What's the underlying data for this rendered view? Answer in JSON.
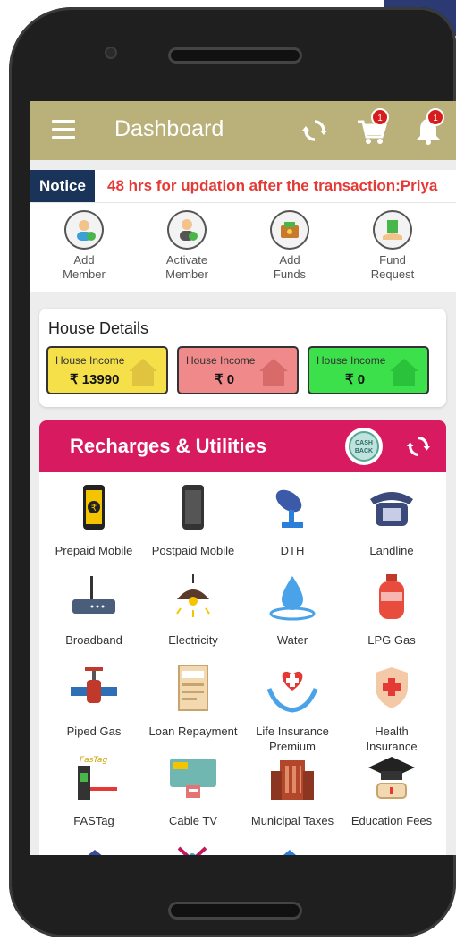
{
  "app": {
    "title": "Dashboard",
    "cart_count": "1",
    "notification_count": "1"
  },
  "notice": {
    "label": "Notice",
    "text": "48 hrs for updation after the transaction:Priya"
  },
  "quick_actions": [
    {
      "label": "Add\nMember",
      "icon": "add-member-icon"
    },
    {
      "label": "Activate\nMember",
      "icon": "activate-member-icon"
    },
    {
      "label": "Add\nFunds",
      "icon": "add-funds-icon"
    },
    {
      "label": "Fund\nRequest",
      "icon": "fund-request-icon"
    }
  ],
  "house": {
    "title": "House Details",
    "boxes": [
      {
        "label": "House Income",
        "value": "₹ 13990",
        "color": "#f5e04a"
      },
      {
        "label": "House Income",
        "value": "₹ 0",
        "color": "#f08a8a"
      },
      {
        "label": "House Income",
        "value": "₹ 0",
        "color": "#3be04a"
      }
    ]
  },
  "recharges": {
    "title": "Recharges & Utilities",
    "cashback_text": "CASH BACK",
    "items": [
      {
        "label": "Prepaid Mobile",
        "icon": "prepaid-mobile-icon"
      },
      {
        "label": "Postpaid Mobile",
        "icon": "postpaid-mobile-icon"
      },
      {
        "label": "DTH",
        "icon": "dth-dish-icon"
      },
      {
        "label": "Landline",
        "icon": "landline-phone-icon"
      },
      {
        "label": "Broadband",
        "icon": "router-icon"
      },
      {
        "label": "Electricity",
        "icon": "lamp-icon"
      },
      {
        "label": "Water",
        "icon": "water-drop-icon"
      },
      {
        "label": "LPG Gas",
        "icon": "gas-cylinder-icon"
      },
      {
        "label": "Piped Gas",
        "icon": "gas-pipe-icon"
      },
      {
        "label": "Loan Repayment",
        "icon": "loan-document-icon"
      },
      {
        "label": "Life Insurance\nPremium",
        "icon": "heart-hands-icon"
      },
      {
        "label": "Health\nInsurance",
        "icon": "health-shield-icon"
      },
      {
        "label": "FASTag",
        "icon": "fastag-toll-icon"
      },
      {
        "label": "Cable TV",
        "icon": "cable-tv-icon"
      },
      {
        "label": "Municipal Taxes",
        "icon": "building-icon"
      },
      {
        "label": "Education Fees",
        "icon": "graduation-cap-icon"
      }
    ]
  },
  "colors": {
    "appbar": "#b9b07a",
    "notice_bg": "#1a3358",
    "notice_text": "#e53935",
    "recharge_header": "#d81b60"
  }
}
